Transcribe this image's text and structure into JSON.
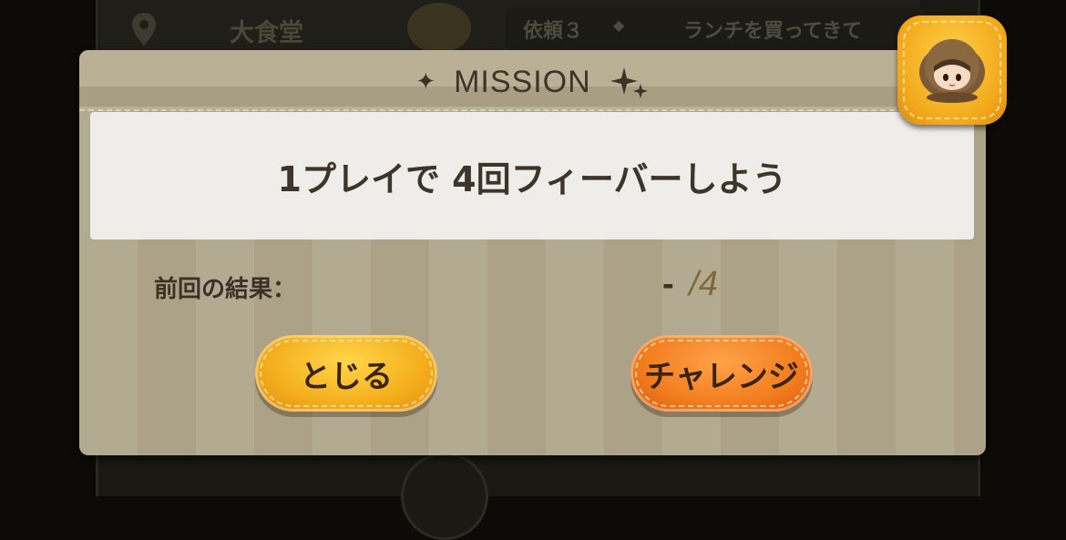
{
  "background": {
    "location": "大食堂",
    "request_label": "依頼３",
    "request_dot": "◆",
    "request_text": "ランチを買ってきて"
  },
  "dialog": {
    "title": "MISSION",
    "sparkle_left": "✦",
    "sparkle_right": "✦",
    "mission_text": "1プレイで 4回フィーバーしよう",
    "result_label": "前回の結果：",
    "result_current": "-",
    "result_total": "/4"
  },
  "buttons": {
    "close_label": "とじる",
    "challenge_label": "チャレンジ"
  },
  "colors": {
    "close_button": "#f4ae1c",
    "challenge_button": "#f27d1e",
    "dialog_bg": "#b3aa92",
    "mission_box": "#efedea"
  }
}
